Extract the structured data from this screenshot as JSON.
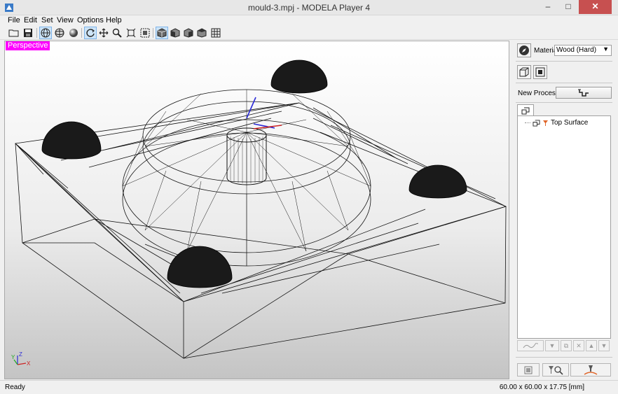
{
  "window": {
    "title": "mould-3.mpj - MODELA Player 4",
    "controls": {
      "minimize": "–",
      "maximize": "□",
      "close": "✕"
    }
  },
  "menu": [
    "File",
    "Edit",
    "Set",
    "View",
    "Options",
    "Help"
  ],
  "toolbar": {
    "buttons": [
      "open-icon",
      "save-icon",
      "wireframe-view-icon",
      "grid-sphere-icon",
      "shaded-sphere-icon",
      "rotate-icon",
      "pan-icon",
      "zoom-icon",
      "zoom-fit-icon",
      "zoom-window-icon",
      "cube-perspective-icon",
      "cube-front-icon",
      "cube-side-icon",
      "cube-top-icon",
      "view-grid-icon"
    ]
  },
  "viewport": {
    "view_label": "Perspective",
    "axes": {
      "x": "X",
      "y": "Y",
      "z": "Z"
    }
  },
  "panel": {
    "material_label": "Material",
    "material_value": "Wood (Hard)",
    "new_process_label": "New Process",
    "tree_items": [
      {
        "label": "Top Surface"
      }
    ]
  },
  "status": {
    "left": "Ready",
    "right": "60.00 x 60.00 x 17.75 [mm]"
  },
  "colors": {
    "view_label_bg": "#ff00ff",
    "close_button": "#c75050",
    "accent": "#3399ff"
  }
}
